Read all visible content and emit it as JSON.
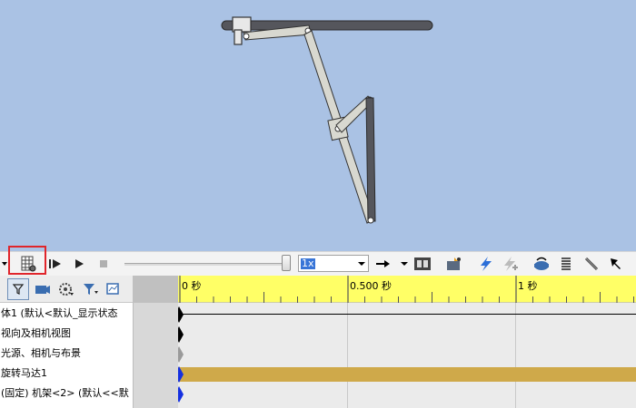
{
  "toolbar": {
    "speed": "1x",
    "colors": {
      "highlight": "#e0252b",
      "selection": "#3875d7",
      "viewport_bg": "#aac2e4"
    }
  },
  "timeline": {
    "ticks": [
      {
        "label": "0 秒"
      },
      {
        "label": "0.500 秒"
      },
      {
        "label": "1 秒"
      }
    ],
    "colors": {
      "ruler": "#ffff66",
      "track": "#cfa94a",
      "key_blue": "#1530e0"
    }
  },
  "tree": {
    "rows": [
      {
        "label": "体1 (默认<默认_显示状态"
      },
      {
        "label": "视向及相机视图"
      },
      {
        "label": "光源、相机与布景"
      },
      {
        "label": "旋转马达1"
      },
      {
        "label": "(固定) 机架<2> (默认<<默"
      }
    ]
  }
}
